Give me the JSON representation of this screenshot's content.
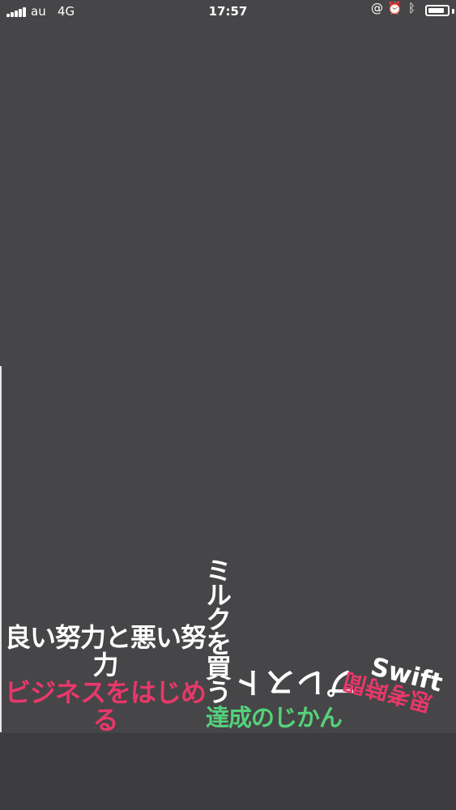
{
  "status_bar": {
    "carrier": "au",
    "network": "4G",
    "time": "17:57",
    "icons": [
      "at-lock-icon",
      "alarm-icon",
      "bluetooth-icon",
      "battery-icon"
    ],
    "battery_level": 0.85
  },
  "canvas": {
    "labels": [
      {
        "id": "good-effort",
        "text": "良い努力と悪い努力",
        "color": "#ffffff"
      },
      {
        "id": "business",
        "text": "ビジネスをはじめる",
        "color": "#e8386a"
      },
      {
        "id": "milk",
        "text": "ミルクを買う",
        "color": "#ffffff"
      },
      {
        "id": "presto",
        "text": "プレスト",
        "color": "#ffffff"
      },
      {
        "id": "achieve",
        "text": "達成のじかん",
        "color": "#55d17a"
      },
      {
        "id": "swift",
        "text": "Swift",
        "color": "#ffffff"
      },
      {
        "id": "thinking",
        "text": "思考時間",
        "color": "#e8386a"
      }
    ]
  }
}
